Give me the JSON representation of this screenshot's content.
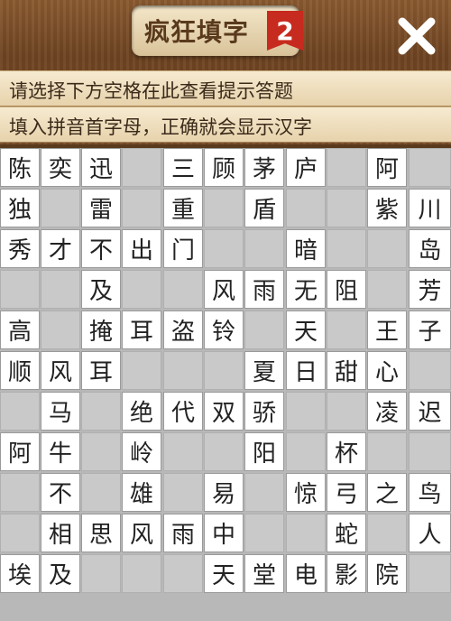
{
  "app": {
    "title": "疯狂填字",
    "badge": "2"
  },
  "hints": {
    "line1": "请选择下方空格在此查看提示答题",
    "line2": "填入拼音首字母，正确就会显示汉字"
  },
  "grid": [
    [
      "陈",
      "奕",
      "迅",
      "#",
      "三",
      "顾",
      "茅",
      "庐",
      "#",
      "阿",
      "#"
    ],
    [
      "独",
      "#",
      "雷",
      "#",
      "重",
      "#",
      "盾",
      "#",
      "#",
      "紫",
      "川"
    ],
    [
      "秀",
      "才",
      "不",
      "出",
      "门",
      "#",
      "#",
      "暗",
      "#",
      "#",
      "岛"
    ],
    [
      "#",
      "#",
      "及",
      "#",
      "#",
      "风",
      "雨",
      "无",
      "阻",
      "#",
      "芳"
    ],
    [
      "高",
      "#",
      "掩",
      "耳",
      "盗",
      "铃",
      "#",
      "天",
      "#",
      "王",
      "子"
    ],
    [
      "顺",
      "风",
      "耳",
      "#",
      "#",
      "#",
      "夏",
      "日",
      "甜",
      "心",
      "#"
    ],
    [
      "#",
      "马",
      "#",
      "绝",
      "代",
      "双",
      "骄",
      "#",
      "#",
      "凌",
      "迟"
    ],
    [
      "阿",
      "牛",
      "#",
      "岭",
      "#",
      "#",
      "阳",
      "#",
      "杯",
      "#",
      "#"
    ],
    [
      "#",
      "不",
      "#",
      "雄",
      "#",
      "易",
      "#",
      "惊",
      "弓",
      "之",
      "鸟"
    ],
    [
      "#",
      "相",
      "思",
      "风",
      "雨",
      "中",
      "#",
      "#",
      "蛇",
      "#",
      "人"
    ],
    [
      "埃",
      "及",
      "#",
      "#",
      "#",
      "天",
      "堂",
      "电",
      "影",
      "院",
      "#"
    ]
  ],
  "colors": {
    "wood": "#7a4e2a",
    "cell_open": "#ffffff",
    "cell_blocked": "#c9c9c9",
    "badge": "#c72a1e"
  },
  "icons": {
    "close": "close-icon"
  }
}
